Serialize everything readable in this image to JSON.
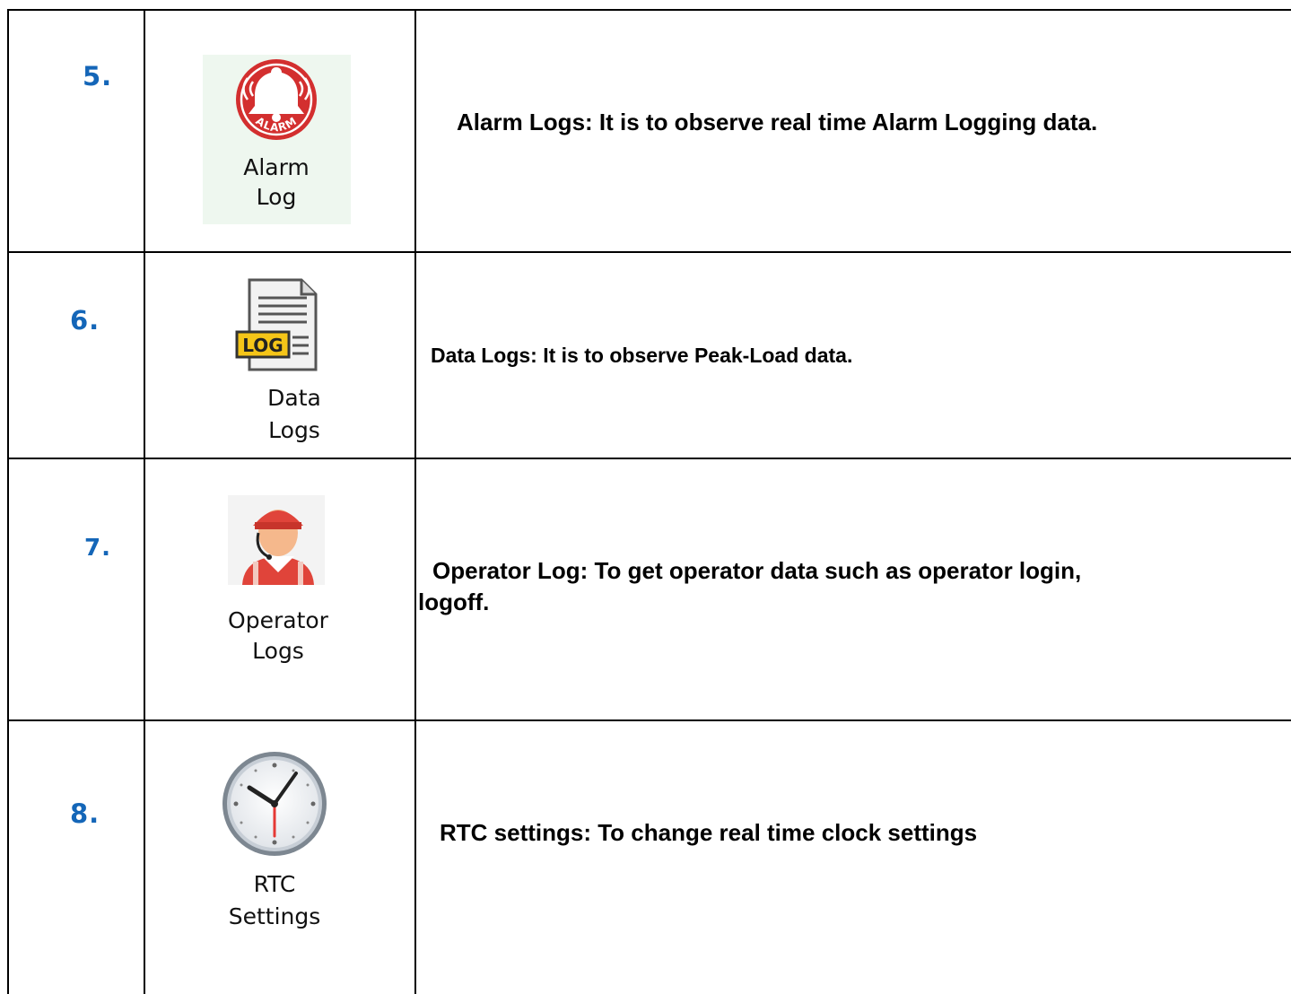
{
  "rows": [
    {
      "number": "5.",
      "icon_name": "alarm-bell-icon",
      "icon_badge": "ALARM",
      "icon_label_1": "Alarm",
      "icon_label_2": "Log",
      "description": "Alarm Logs: It is to observe real time Alarm Logging data."
    },
    {
      "number": "6.",
      "icon_name": "log-document-icon",
      "icon_badge": "LOG",
      "icon_label_1": "Data",
      "icon_label_2": "Logs",
      "description": "Data Logs: It is to observe Peak-Load data."
    },
    {
      "number": "7.",
      "icon_name": "operator-headset-icon",
      "icon_label_1": "Operator",
      "icon_label_2": "Logs",
      "description_1": "Operator Log: To get operator data such as operator login,",
      "description_2": "logoff."
    },
    {
      "number": "8.",
      "icon_name": "clock-icon",
      "icon_label_1": "RTC",
      "icon_label_2": "Settings",
      "description": "RTC settings: To change real time clock settings"
    }
  ],
  "colors": {
    "number": "#1466b8",
    "alarm_red": "#d32f2f",
    "log_yellow": "#f5c518",
    "operator_red": "#e0443a",
    "clock_hand": "#e53935"
  }
}
